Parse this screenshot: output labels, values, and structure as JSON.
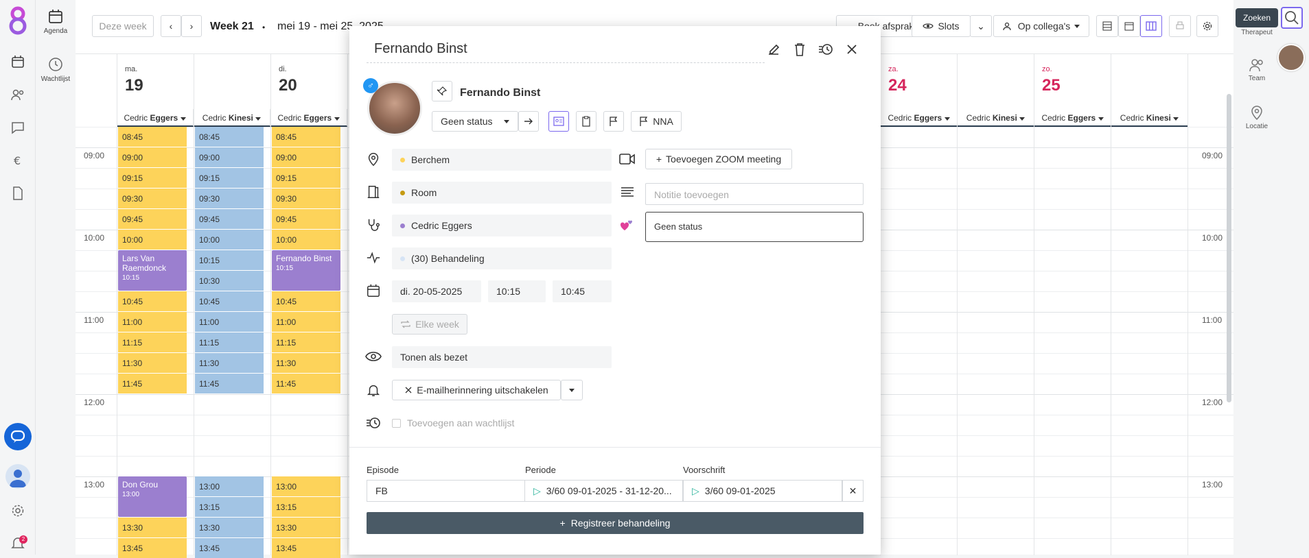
{
  "nav": {
    "agenda_label": "Agenda",
    "waitlist_label": "Wachtlijst",
    "notification_count": "2"
  },
  "rail": {
    "therapeut_label": "Therapeut",
    "team_label": "Team",
    "location_label": "Locatie",
    "search_tooltip": "Zoeken"
  },
  "toolbar": {
    "this_week": "Deze week",
    "week_label": "Week 21",
    "bullet": "•",
    "date_range": "mei 19 - mei 25, 2025",
    "book_label": "Boek afspraken",
    "slots_label": "Slots",
    "colleagues_label": "Op collega's"
  },
  "calendar": {
    "days": [
      {
        "name": "ma.",
        "num": "19"
      },
      {
        "name": "di.",
        "num": "20"
      },
      {
        "name": "za.",
        "num": "24"
      },
      {
        "name": "zo.",
        "num": "25"
      }
    ],
    "columns": [
      {
        "first": "Cedric",
        "last": "Eggers"
      },
      {
        "first": "Cedric",
        "last": "Kinesi"
      },
      {
        "first": "Cedric",
        "last": "Eggers"
      },
      {
        "first": "Cedric",
        "last": "Eggers"
      },
      {
        "first": "Cedric",
        "last": "Kinesi"
      },
      {
        "first": "Cedric",
        "last": "Eggers"
      },
      {
        "first": "Cedric",
        "last": "Kinesi"
      }
    ],
    "hours": [
      "09:00",
      "10:00",
      "11:00",
      "12:00",
      "13:00"
    ],
    "partial_slot": "08:45",
    "slots_morning": [
      "09:00",
      "09:15",
      "09:30",
      "09:45",
      "10:00"
    ],
    "slots_mid_blue": [
      "10:15",
      "10:30"
    ],
    "slots_late": [
      "10:45",
      "11:00",
      "11:15",
      "11:30",
      "11:45"
    ],
    "slots_afternoon": [
      "13:00",
      "13:15",
      "13:30",
      "13:45"
    ],
    "appointments": {
      "lars": {
        "name": "Lars Van Raemdonck",
        "time": "10:15"
      },
      "fernando": {
        "name": "Fernando Binst",
        "time": "10:15"
      },
      "don": {
        "name": "Don Grou",
        "time": "13:00"
      }
    }
  },
  "modal": {
    "title": "Fernando Binst",
    "patient_name": "Fernando Binst",
    "status_select": "Geen status",
    "nna_label": "NNA",
    "location": "Berchem",
    "room": "Room",
    "therapist": "Cedric Eggers",
    "treatment": "(30) Behandeling",
    "date": "di. 20-05-2025",
    "start_time": "10:15",
    "end_time": "10:45",
    "repeat_label": "Elke week",
    "show_busy": "Tonen als bezet",
    "email_reminder": "E-mailherinnering uitschakelen",
    "waitlist_checkbox": "Toevoegen aan wachtlijst",
    "zoom_label": "Toevoegen ZOOM meeting",
    "note_placeholder": "Notitie toevoegen",
    "status_box": "Geen status",
    "episode_label": "Episode",
    "period_label": "Periode",
    "prescription_label": "Voorschrift",
    "episode_value": "FB",
    "period_value": "3/60 09-01-2025 - 31-12-20...",
    "prescription_value": "3/60 09-01-2025",
    "register_button": "Registreer behandeling"
  },
  "colors": {
    "slot_yellow": "#fdd35a",
    "slot_blue": "#a2c4e4",
    "appointment_purple": "#9b7fcf",
    "accent_purple": "#7b68ee",
    "weekend_red": "#d6265c",
    "register_bg": "#4a5a66"
  }
}
